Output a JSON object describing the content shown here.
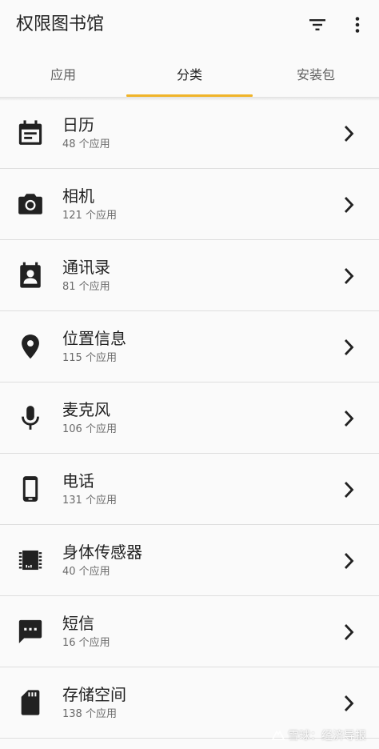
{
  "app": {
    "title": "权限图书馆"
  },
  "toolbar": {
    "filter_icon": "filter-list-icon",
    "more_icon": "more-vert-icon"
  },
  "tabs": [
    {
      "label": "应用",
      "active": false
    },
    {
      "label": "分类",
      "active": true
    },
    {
      "label": "安装包",
      "active": false
    }
  ],
  "colors": {
    "accent": "#f0b429",
    "text_primary": "#212121",
    "text_secondary": "#6a6a6a",
    "divider": "#dedede",
    "background": "#fafafa"
  },
  "categories": [
    {
      "title": "日历",
      "subtitle": "48 个应用",
      "icon": "calendar-icon"
    },
    {
      "title": "相机",
      "subtitle": "121 个应用",
      "icon": "camera-icon"
    },
    {
      "title": "通讯录",
      "subtitle": "81 个应用",
      "icon": "contacts-icon"
    },
    {
      "title": "位置信息",
      "subtitle": "115 个应用",
      "icon": "location-pin-icon"
    },
    {
      "title": "麦克风",
      "subtitle": "106 个应用",
      "icon": "microphone-icon"
    },
    {
      "title": "电话",
      "subtitle": "131 个应用",
      "icon": "phone-icon"
    },
    {
      "title": "身体传感器",
      "subtitle": "40 个应用",
      "icon": "sensor-chip-icon"
    },
    {
      "title": "短信",
      "subtitle": "16 个应用",
      "icon": "sms-icon"
    },
    {
      "title": "存储空间",
      "subtitle": "138 个应用",
      "icon": "sd-card-icon"
    }
  ],
  "watermark": {
    "text": "雪球：经济导报"
  }
}
